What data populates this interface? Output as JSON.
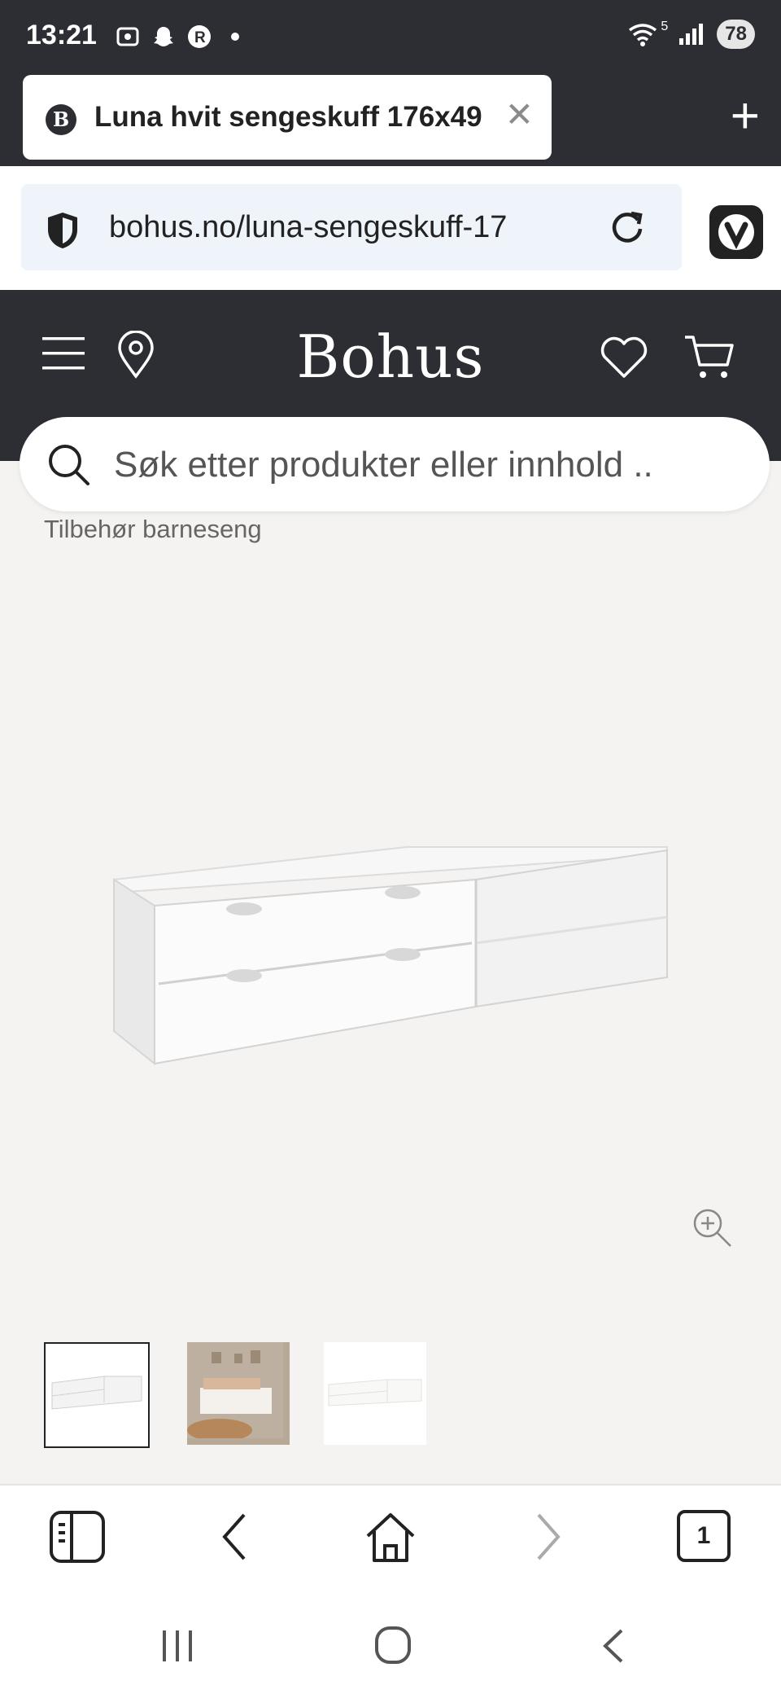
{
  "status_bar": {
    "time": "13:21",
    "battery": "78",
    "network": "5"
  },
  "browser": {
    "tab_title": "Luna hvit sengeskuff 176x49",
    "favicon_letter": "B",
    "url": "bohus.no/luna-sengeskuff-17",
    "open_tabs": "1"
  },
  "site": {
    "logo": "Bohus",
    "search_placeholder": "Søk etter produkter eller innhold ..",
    "breadcrumb": "Tilbehør barneseng"
  },
  "icons": [
    "menu-icon",
    "location-pin-icon",
    "heart-icon",
    "cart-icon",
    "search-icon",
    "zoom-in-icon",
    "shield-icon",
    "reload-icon",
    "vivaldi-icon",
    "panel-icon",
    "back-icon",
    "home-icon",
    "forward-icon",
    "tabs-icon"
  ],
  "colors": {
    "header_bg": "#2d2e34",
    "page_bg": "#f4f3f1",
    "address_bg": "#eff3fa"
  }
}
